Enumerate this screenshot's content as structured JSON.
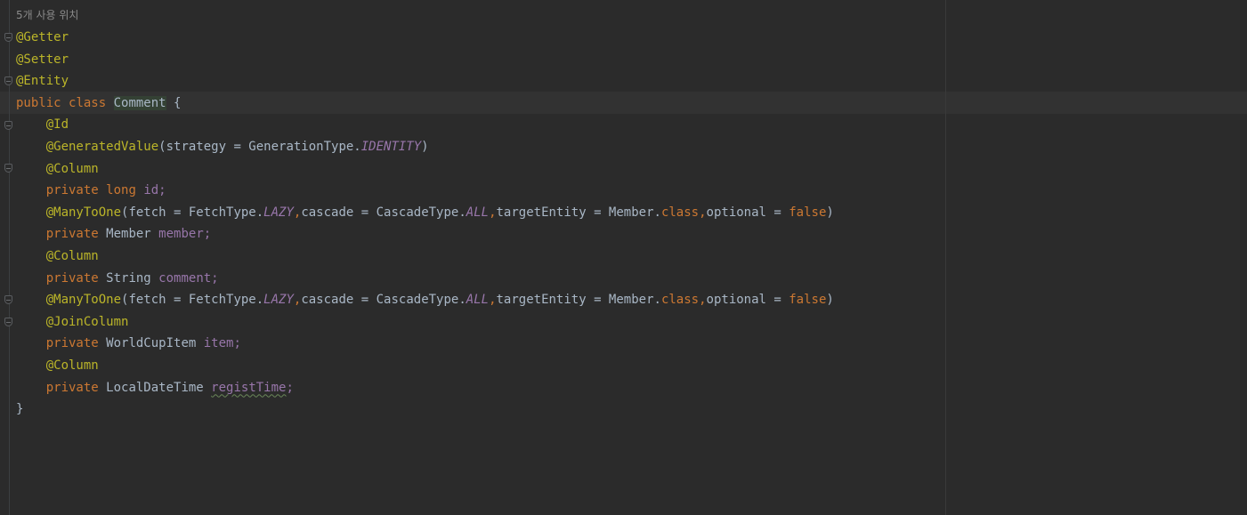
{
  "editor": {
    "usage_hint": "5개 사용 위치",
    "lines": [
      {
        "segs": [
          {
            "t": "@Getter",
            "c": "ann"
          }
        ]
      },
      {
        "segs": [
          {
            "t": "@Setter",
            "c": "ann"
          }
        ]
      },
      {
        "segs": [
          {
            "t": "@Entity",
            "c": "ann"
          }
        ]
      },
      {
        "segs": [
          {
            "t": "public ",
            "c": "kw"
          },
          {
            "t": "class ",
            "c": "kw"
          },
          {
            "t": "Comment",
            "c": "hl"
          },
          {
            "t": " {",
            "c": "txt"
          }
        ]
      },
      {
        "segs": [
          {
            "t": "    ",
            "c": "txt"
          },
          {
            "t": "@Id",
            "c": "ann"
          }
        ]
      },
      {
        "segs": [
          {
            "t": "    ",
            "c": "txt"
          },
          {
            "t": "@GeneratedValue",
            "c": "ann"
          },
          {
            "t": "(strategy = GenerationType.",
            "c": "txt"
          },
          {
            "t": "IDENTITY",
            "c": "sfld"
          },
          {
            "t": ")",
            "c": "txt"
          }
        ]
      },
      {
        "segs": [
          {
            "t": "    ",
            "c": "txt"
          },
          {
            "t": "@Column",
            "c": "ann"
          }
        ]
      },
      {
        "segs": [
          {
            "t": "    ",
            "c": "txt"
          },
          {
            "t": "private ",
            "c": "kw"
          },
          {
            "t": "long ",
            "c": "kw"
          },
          {
            "t": "id;",
            "c": "fld"
          }
        ]
      },
      {
        "segs": [
          {
            "t": "    ",
            "c": "txt"
          },
          {
            "t": "@ManyToOne",
            "c": "ann"
          },
          {
            "t": "(fetch = FetchType.",
            "c": "txt"
          },
          {
            "t": "LAZY",
            "c": "sfld"
          },
          {
            "t": ",",
            "c": "kw"
          },
          {
            "t": "cascade = CascadeType.",
            "c": "txt"
          },
          {
            "t": "ALL",
            "c": "sfld"
          },
          {
            "t": ",",
            "c": "kw"
          },
          {
            "t": "targetEntity = Member.",
            "c": "txt"
          },
          {
            "t": "class",
            "c": "kw"
          },
          {
            "t": ",",
            "c": "kw"
          },
          {
            "t": "optional = ",
            "c": "txt"
          },
          {
            "t": "false",
            "c": "kw"
          },
          {
            "t": ")",
            "c": "txt"
          }
        ]
      },
      {
        "segs": [
          {
            "t": "    ",
            "c": "txt"
          },
          {
            "t": "private ",
            "c": "kw"
          },
          {
            "t": "Member ",
            "c": "txt"
          },
          {
            "t": "member;",
            "c": "fld"
          }
        ]
      },
      {
        "segs": [
          {
            "t": "    ",
            "c": "txt"
          },
          {
            "t": "@Column",
            "c": "ann"
          }
        ]
      },
      {
        "segs": [
          {
            "t": "    ",
            "c": "txt"
          },
          {
            "t": "private ",
            "c": "kw"
          },
          {
            "t": "String ",
            "c": "txt"
          },
          {
            "t": "comment;",
            "c": "fld"
          }
        ]
      },
      {
        "segs": [
          {
            "t": "    ",
            "c": "txt"
          },
          {
            "t": "@ManyToOne",
            "c": "ann"
          },
          {
            "t": "(fetch = FetchType.",
            "c": "txt"
          },
          {
            "t": "LAZY",
            "c": "sfld"
          },
          {
            "t": ",",
            "c": "kw"
          },
          {
            "t": "cascade = CascadeType.",
            "c": "txt"
          },
          {
            "t": "ALL",
            "c": "sfld"
          },
          {
            "t": ",",
            "c": "kw"
          },
          {
            "t": "targetEntity = Member.",
            "c": "txt"
          },
          {
            "t": "class",
            "c": "kw"
          },
          {
            "t": ",",
            "c": "kw"
          },
          {
            "t": "optional = ",
            "c": "txt"
          },
          {
            "t": "false",
            "c": "kw"
          },
          {
            "t": ")",
            "c": "txt"
          }
        ]
      },
      {
        "segs": [
          {
            "t": "    ",
            "c": "txt"
          },
          {
            "t": "@JoinColumn",
            "c": "ann"
          }
        ]
      },
      {
        "segs": [
          {
            "t": "    ",
            "c": "txt"
          },
          {
            "t": "private ",
            "c": "kw"
          },
          {
            "t": "WorldCupItem ",
            "c": "txt"
          },
          {
            "t": "item;",
            "c": "fld"
          }
        ]
      },
      {
        "segs": [
          {
            "t": "    ",
            "c": "txt"
          },
          {
            "t": "@Column",
            "c": "ann"
          }
        ]
      },
      {
        "segs": [
          {
            "t": "    ",
            "c": "txt"
          },
          {
            "t": "private ",
            "c": "kw"
          },
          {
            "t": "LocalDateTime ",
            "c": "txt"
          },
          {
            "t": "registTime",
            "c": "fld squiggle"
          },
          {
            "t": ";",
            "c": "fld"
          }
        ]
      },
      {
        "segs": [
          {
            "t": "}",
            "c": "txt"
          }
        ]
      }
    ]
  },
  "colors": {
    "background": "#2b2b2b",
    "annotation": "#bbb529",
    "keyword": "#cc7832",
    "field": "#9876aa",
    "text": "#a9b7c6"
  },
  "fold_markers": [
    "fold-icon-getter",
    "fold-icon-entity",
    "fold-icon-id",
    "fold-icon-column",
    "fold-icon-manytoone",
    "fold-icon-joincolumn"
  ]
}
